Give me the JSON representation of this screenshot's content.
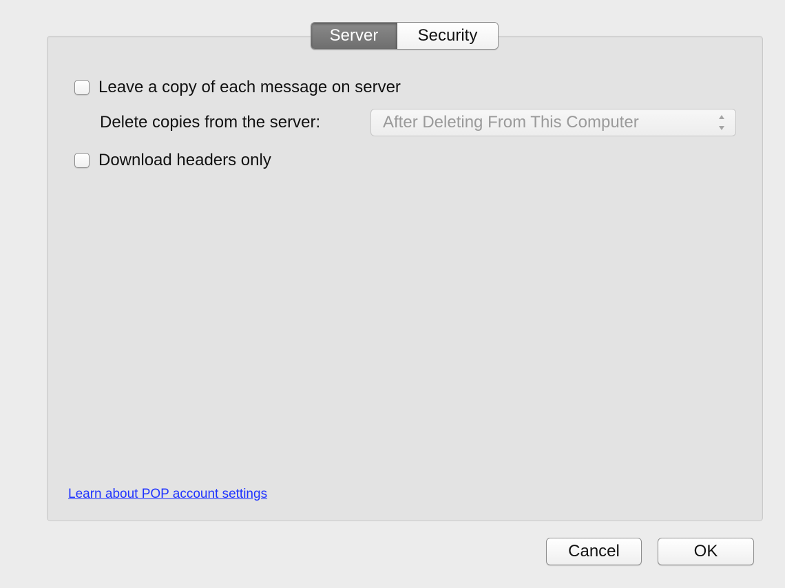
{
  "tabs": [
    {
      "label": "Server",
      "selected": true
    },
    {
      "label": "Security",
      "selected": false
    }
  ],
  "options": {
    "leave_copy": {
      "label": "Leave a copy of each message on server",
      "checked": false
    },
    "delete_copies": {
      "label": "Delete copies from the server:",
      "selected_value": "After Deleting From This Computer",
      "enabled": false
    },
    "headers_only": {
      "label": "Download headers only",
      "checked": false
    }
  },
  "help_link": "Learn about POP account settings",
  "buttons": {
    "cancel": "Cancel",
    "ok": "OK"
  },
  "colors": {
    "link": "#1f33ff",
    "selected_tab": "#7a7a7a",
    "panel_bg": "#e3e3e3",
    "window_bg": "#ececec"
  }
}
